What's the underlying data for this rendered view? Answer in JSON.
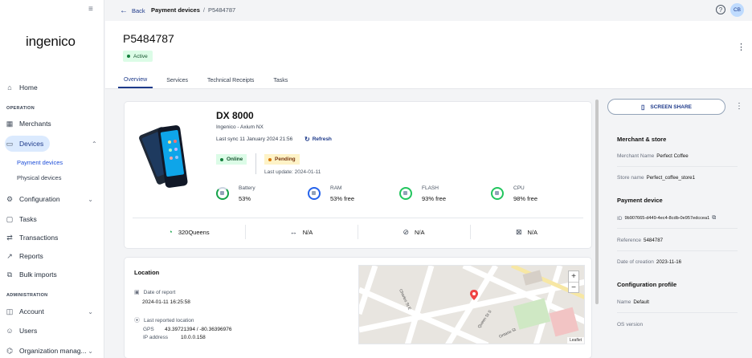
{
  "sidebar": {
    "logo": "ingenico",
    "collapse_icon": "collapse-icon",
    "sections": {
      "operation": "OPERATION",
      "administration": "ADMINISTRATION"
    },
    "items": {
      "home": "Home",
      "merchants": "Merchants",
      "devices": "Devices",
      "payment_devices": "Payment devices",
      "physical_devices": "Physical devices",
      "configuration": "Configuration",
      "tasks": "Tasks",
      "transactions": "Transactions",
      "reports": "Reports",
      "bulk_imports": "Bulk imports",
      "account": "Account",
      "users": "Users",
      "organization": "Organization manag..."
    }
  },
  "topbar": {
    "back": "Back",
    "breadcrumb_parent": "Payment devices",
    "breadcrumb_sep": "/",
    "breadcrumb_current": "P5484787",
    "avatar": "CB",
    "help": "?"
  },
  "header": {
    "title": "P5484787",
    "status": "Active",
    "tabs": [
      "Overview",
      "Services",
      "Technical Receipts",
      "Tasks"
    ]
  },
  "device": {
    "name": "DX 8000",
    "model": "Ingenico - Axium NX",
    "last_sync": "Last sync 11 January 2024 21:56",
    "refresh": "Refresh",
    "online": "Online",
    "pending": "Pending",
    "last_update": "Last update: 2024-01-11",
    "metrics": [
      {
        "label": "Battery",
        "value": "53%"
      },
      {
        "label": "RAM",
        "value": "53% free"
      },
      {
        "label": "FLASH",
        "value": "93% free"
      },
      {
        "label": "CPU",
        "value": "98% free"
      }
    ],
    "connectivity": [
      {
        "icon": "wifi-icon",
        "value": "320Queens"
      },
      {
        "icon": "ethernet-icon",
        "value": "N/A"
      },
      {
        "icon": "bluetooth-off-icon",
        "value": "N/A"
      },
      {
        "icon": "sim-off-icon",
        "value": "N/A"
      }
    ]
  },
  "location": {
    "title": "Location",
    "date_label": "Date of report",
    "date_value": "2024-01-11 16:25:58",
    "last_label": "Last reported location",
    "gps_key": "GPS",
    "gps_value": "43.39721394 / -80.36396976",
    "ip_key": "IP address",
    "ip_value": "10.0.0.158",
    "map_attr": "Leaflet",
    "map_street_labels": [
      "Queen St S",
      "Ontario St",
      "Charles St E"
    ]
  },
  "right": {
    "screen_share": "SCREEN SHARE",
    "merchant_store_h": "Merchant & store",
    "merchant_name_k": "Merchant Name",
    "merchant_name_v": "Perfect Coffee",
    "store_name_k": "Store name",
    "store_name_v": "Perfect_coffee_store1",
    "payment_device_h": "Payment device",
    "id_k": "ID",
    "id_v": "9b907665-d449-4ec4-8cdb-0e957edccea1",
    "reference_k": "Reference",
    "reference_v": "5484787",
    "date_creation_k": "Date of creation",
    "date_creation_v": "2023-11-16",
    "config_profile_h": "Configuration profile",
    "name_k": "Name",
    "name_v": "Default",
    "os_version_k": "OS version"
  },
  "colors": {
    "accent": "#1e3a8a",
    "active_bg": "#dcfce7",
    "pending_bg": "#fef3c7",
    "nav_active": "#dbeafe"
  }
}
